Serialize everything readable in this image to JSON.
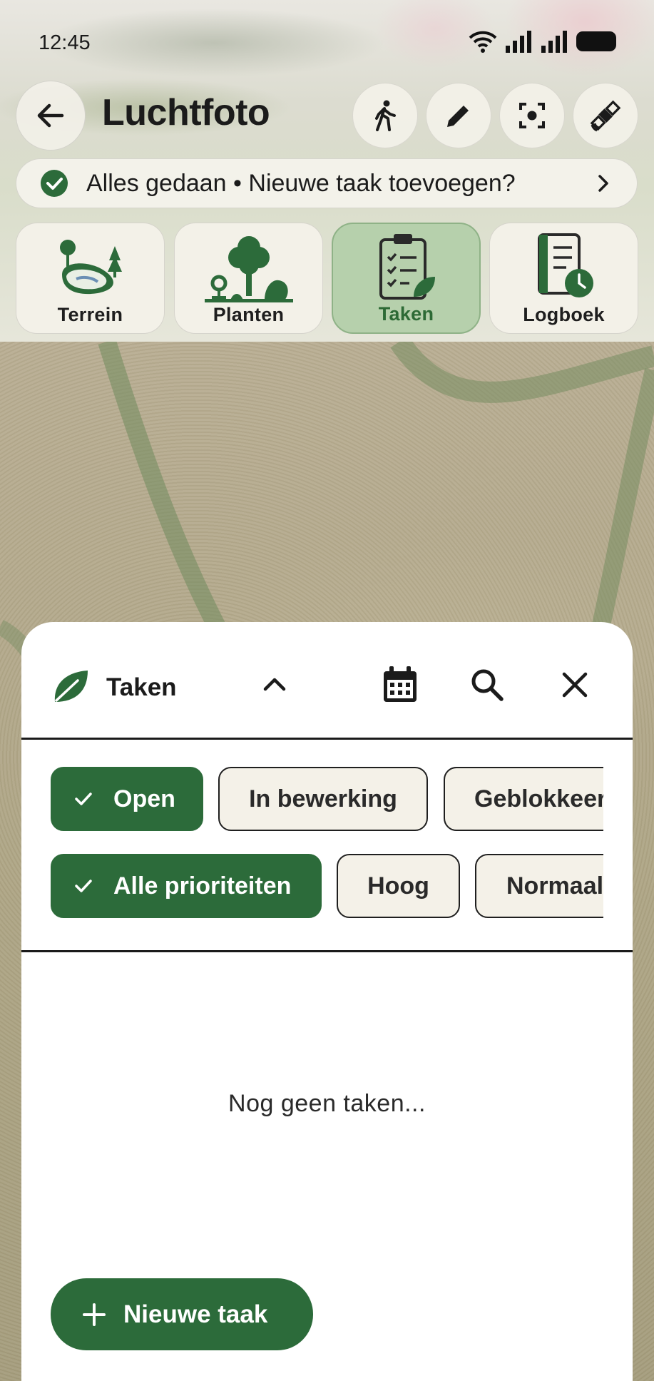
{
  "status_bar": {
    "time": "12:45",
    "icons": [
      "wifi-icon",
      "signal-icon",
      "signal-icon",
      "battery-icon"
    ]
  },
  "header": {
    "title": "Luchtfoto",
    "back_icon": "arrow-left-icon",
    "actions": [
      "walk-icon",
      "pencil-icon",
      "focus-icon",
      "satellite-icon"
    ]
  },
  "banner": {
    "text": "Alles gedaan • Nieuwe taak toevoegen?",
    "icon": "check-circle-icon",
    "chevron": "chevron-right-icon"
  },
  "tiles": [
    {
      "label": "Terrein",
      "icon": "terrain-icon",
      "active": false
    },
    {
      "label": "Planten",
      "icon": "plants-icon",
      "active": false
    },
    {
      "label": "Taken",
      "icon": "clipboard-icon",
      "active": true
    },
    {
      "label": "Logboek",
      "icon": "logbook-icon",
      "active": false
    }
  ],
  "sheet": {
    "title": "Taken",
    "status_filters": [
      {
        "label": "Open",
        "selected": true
      },
      {
        "label": "In bewerking",
        "selected": false
      },
      {
        "label": "Geblokkeer",
        "selected": false
      }
    ],
    "priority_filters": [
      {
        "label": "Alle prioriteiten",
        "selected": true
      },
      {
        "label": "Hoog",
        "selected": false
      },
      {
        "label": "Normaal",
        "selected": false
      }
    ],
    "empty_text": "Nog geen taken...",
    "new_task_label": "Nieuwe taak"
  },
  "colors": {
    "accent": "#2c6b3a",
    "active_tile": "#b6d0ac",
    "chip_bg": "#f4f1e8"
  }
}
